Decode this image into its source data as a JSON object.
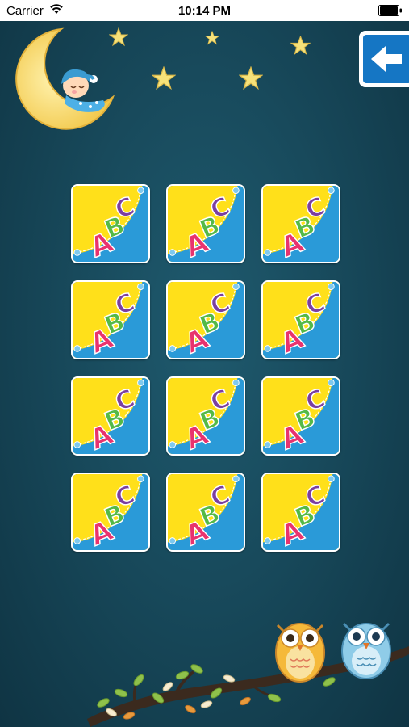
{
  "status_bar": {
    "carrier": "Carrier",
    "time": "10:14 PM"
  },
  "header": {
    "back_button_icon": "arrow-left-icon"
  },
  "grid": {
    "rows": 4,
    "columns": 3,
    "card_face": "abc-card-back",
    "cards": [
      {
        "id": 1
      },
      {
        "id": 2
      },
      {
        "id": 3
      },
      {
        "id": 4
      },
      {
        "id": 5
      },
      {
        "id": 6
      },
      {
        "id": 7
      },
      {
        "id": 8
      },
      {
        "id": 9
      },
      {
        "id": 10
      },
      {
        "id": 11
      },
      {
        "id": 12
      }
    ]
  },
  "colors": {
    "background": "#184a5c",
    "card_yellow": "#ffe01a",
    "card_blue": "#2a9ad8",
    "back_button_blue": "#1576c4"
  }
}
